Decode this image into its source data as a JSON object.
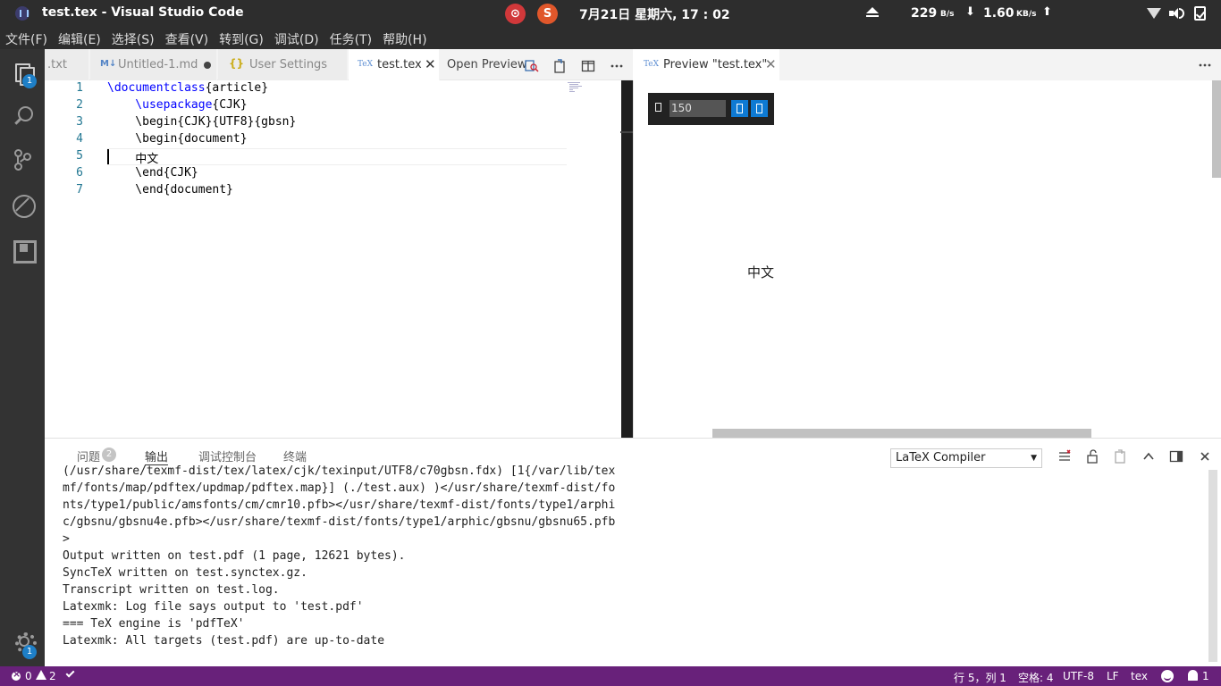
{
  "system": {
    "window_title": "test.tex - Visual Studio Code",
    "tray_netease": "⊙",
    "tray_sogou": "S",
    "clock": "7月21日 星期六, 17 : 02",
    "net_down_value": "229",
    "net_down_unit": "B/s",
    "net_up_value": "1.60",
    "net_up_unit": "KB/s"
  },
  "menu": [
    "文件(F)",
    "编辑(E)",
    "选择(S)",
    "查看(V)",
    "转到(G)",
    "调试(D)",
    "任务(T)",
    "帮助(H)"
  ],
  "activity": {
    "explorer_badge": "1",
    "settings_badge": "1"
  },
  "tabs": [
    {
      "label": ".txt",
      "icon": "none",
      "active": false
    },
    {
      "label": "Untitled-1.md",
      "icon": "markdown-icon",
      "dirty": true
    },
    {
      "label": "User Settings",
      "icon": "json-icon"
    },
    {
      "label": "test.tex",
      "icon": "tex-icon",
      "active": true
    }
  ],
  "editor_actions": {
    "open_preview": "Open Preview"
  },
  "editor": {
    "lines": [
      {
        "num": "1",
        "kw": "\\documentclass",
        "rest": "{article}"
      },
      {
        "num": "2",
        "kw": "    \\usepackage",
        "rest": "{CJK}"
      },
      {
        "num": "3",
        "kw": "",
        "rest": "    \\begin{CJK}{UTF8}{gbsn}"
      },
      {
        "num": "4",
        "kw": "",
        "rest": "    \\begin{document}"
      },
      {
        "num": "5",
        "kw": "",
        "rest": "    中文"
      },
      {
        "num": "6",
        "kw": "",
        "rest": "    \\end{CJK}"
      },
      {
        "num": "7",
        "kw": "",
        "rest": "    \\end{document}"
      }
    ]
  },
  "preview": {
    "tab_label": "Preview \"test.tex\"",
    "zoom_value": "150",
    "pdf_text": "中文"
  },
  "panel": {
    "tabs": [
      "问题",
      "输出",
      "调试控制台",
      "终端"
    ],
    "problems_count": "2",
    "compiler_selected": "LaTeX Compiler",
    "output_lines": [
      "(/usr/share/texmf-dist/tex/latex/cjk/texinput/UTF8/c70gbsn.fdx) [1{/var/lib/tex",
      "mf/fonts/map/pdftex/updmap/pdftex.map}] (./test.aux) )</usr/share/texmf-dist/fo",
      "nts/type1/public/amsfonts/cm/cmr10.pfb></usr/share/texmf-dist/fonts/type1/arphi",
      "c/gbsnu/gbsnu4e.pfb></usr/share/texmf-dist/fonts/type1/arphic/gbsnu/gbsnu65.pfb",
      ">",
      "Output written on test.pdf (1 page, 12621 bytes).",
      "SyncTeX written on test.synctex.gz.",
      "Transcript written on test.log.",
      "Latexmk: Log file says output to 'test.pdf'",
      "=== TeX engine is 'pdfTeX'",
      "Latexmk: All targets (test.pdf) are up-to-date"
    ]
  },
  "status": {
    "errors": "0",
    "warnings": "2",
    "position": "行 5，列 1",
    "indent": "空格: 4",
    "encoding": "UTF-8",
    "eol": "LF",
    "language": "tex",
    "notifications": "1"
  }
}
